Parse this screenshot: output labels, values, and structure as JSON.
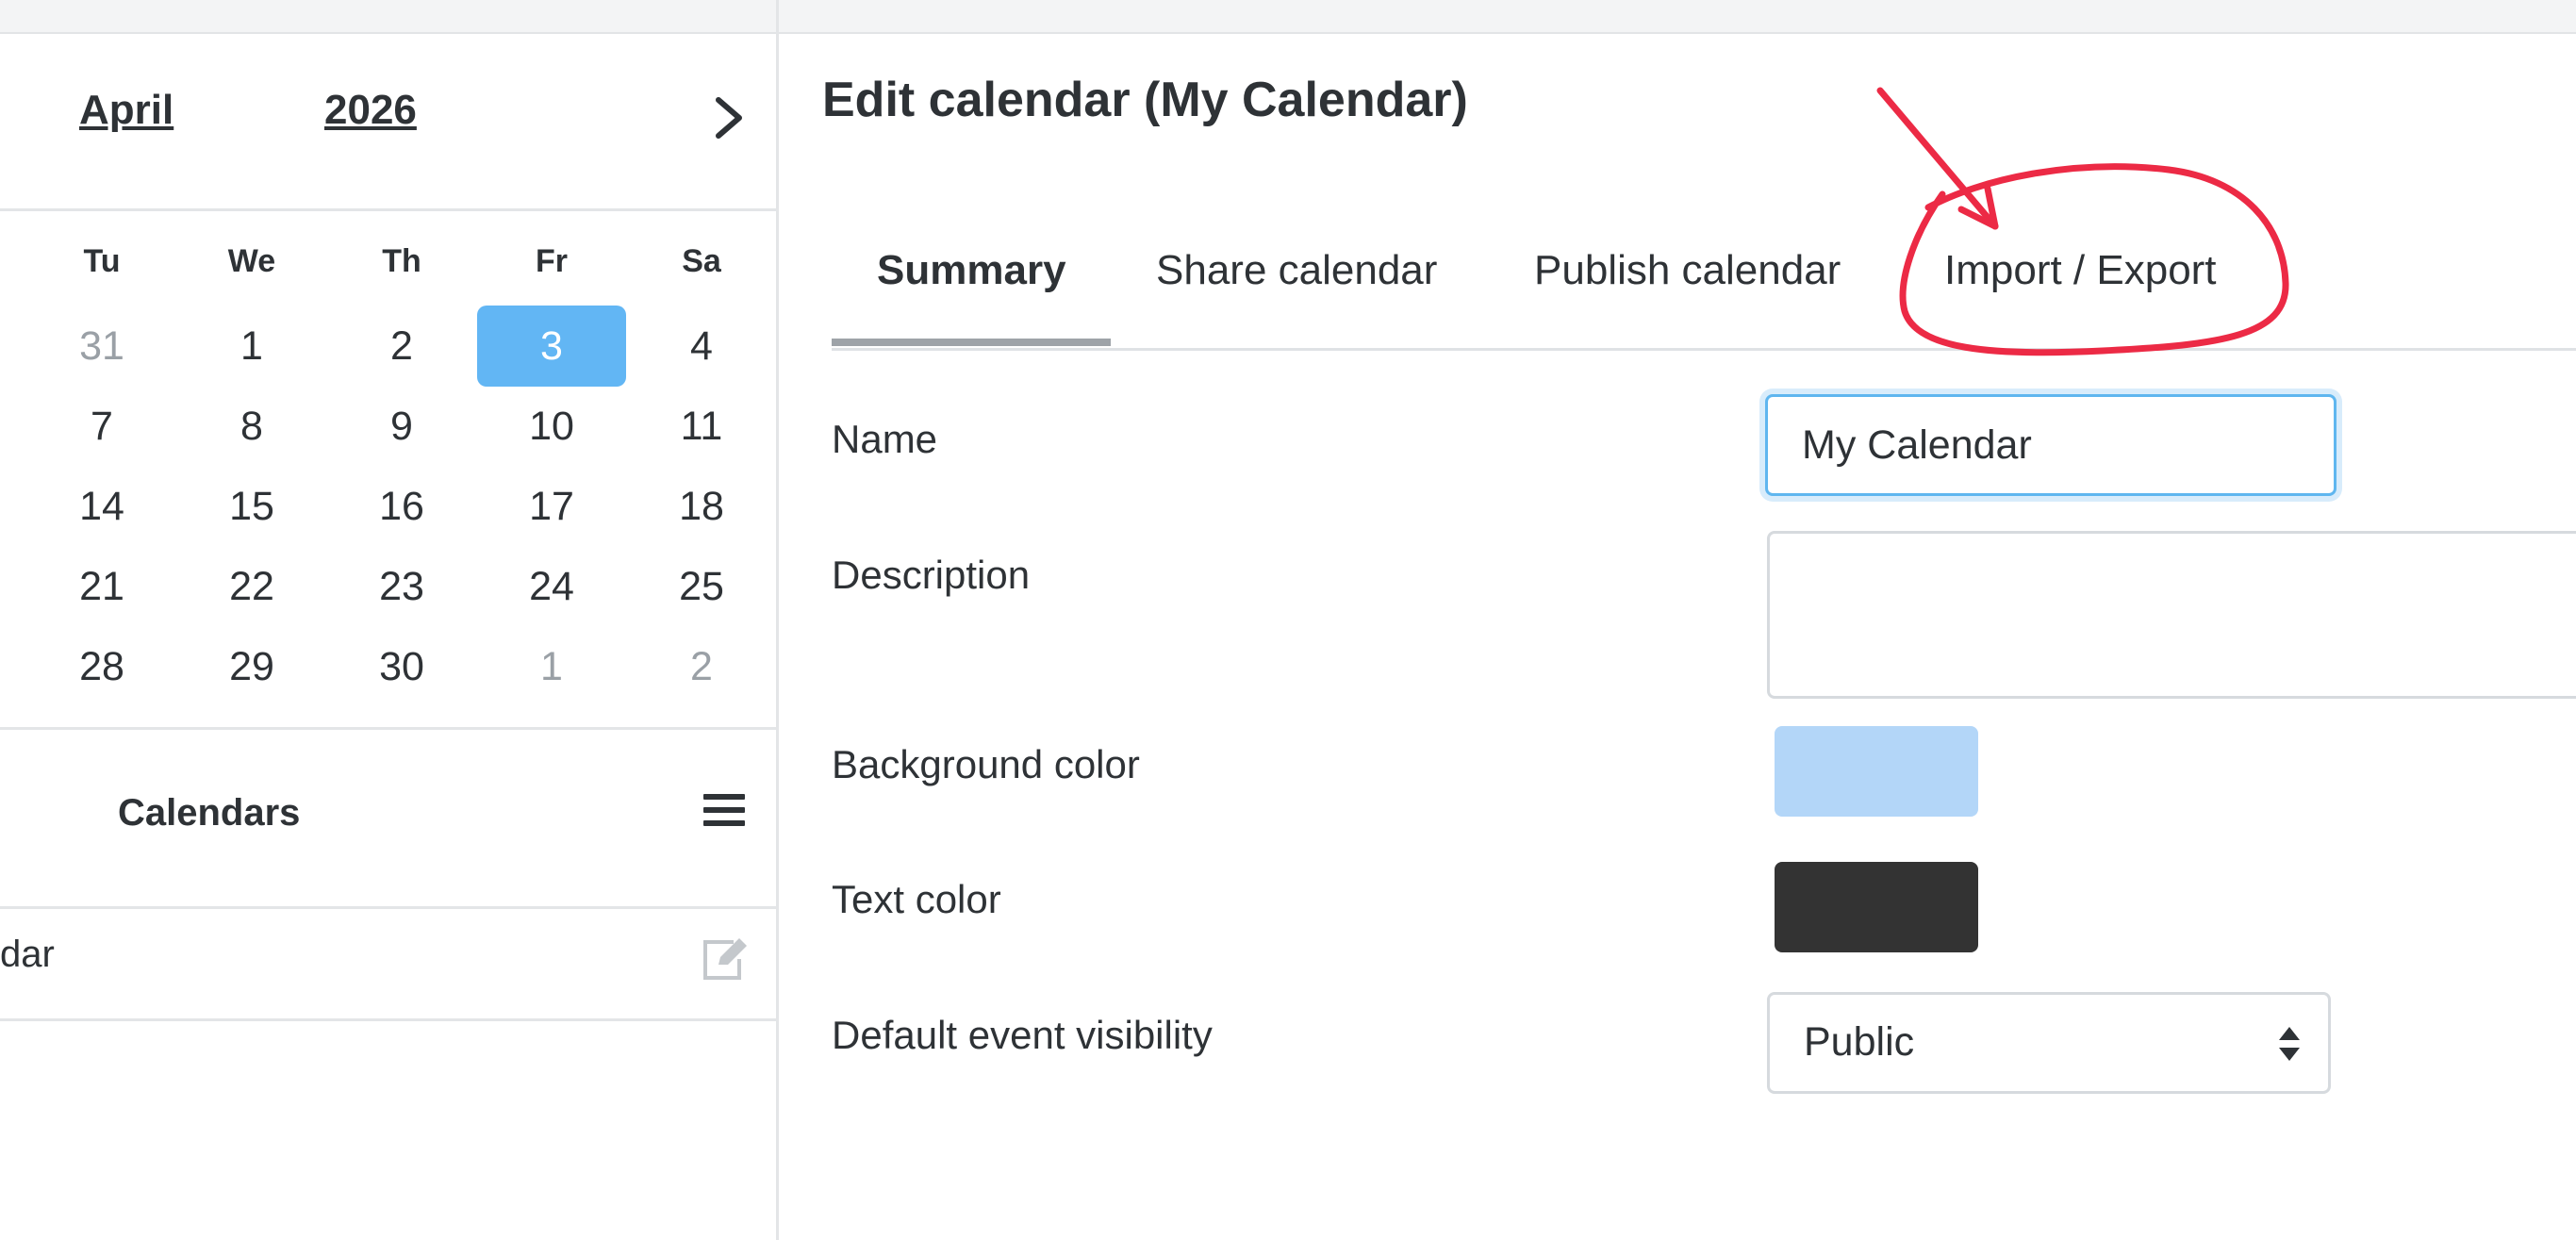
{
  "mini_calendar": {
    "month": "April",
    "year": "2026",
    "weekday_headers": [
      "Tu",
      "We",
      "Th",
      "Fr",
      "Sa"
    ],
    "weeks": [
      [
        "31",
        "1",
        "2",
        "3",
        "4"
      ],
      [
        "7",
        "8",
        "9",
        "10",
        "11"
      ],
      [
        "14",
        "15",
        "16",
        "17",
        "18"
      ],
      [
        "21",
        "22",
        "23",
        "24",
        "25"
      ],
      [
        "28",
        "29",
        "30",
        "1",
        "2"
      ]
    ],
    "selected_day": "3"
  },
  "calendars_panel": {
    "title": "Calendars",
    "item_label": "dar"
  },
  "editor": {
    "title": "Edit calendar (My Calendar)",
    "tabs": [
      "Summary",
      "Share calendar",
      "Publish calendar",
      "Import / Export"
    ],
    "active_tab": "Summary",
    "fields": {
      "name_label": "Name",
      "name_value": "My Calendar",
      "description_label": "Description",
      "description_value": "",
      "background_color_label": "Background color",
      "background_color": "#b3d6f8",
      "text_color_label": "Text color",
      "text_color": "#333333",
      "visibility_label": "Default event visibility",
      "visibility_value": "Public"
    }
  },
  "colors": {
    "accent_today": "#62b6f4",
    "annotation_red": "#ec2a45"
  },
  "icons": [
    "chevron-right-icon",
    "hamburger-menu-icon",
    "edit-icon",
    "select-arrows-icon"
  ]
}
